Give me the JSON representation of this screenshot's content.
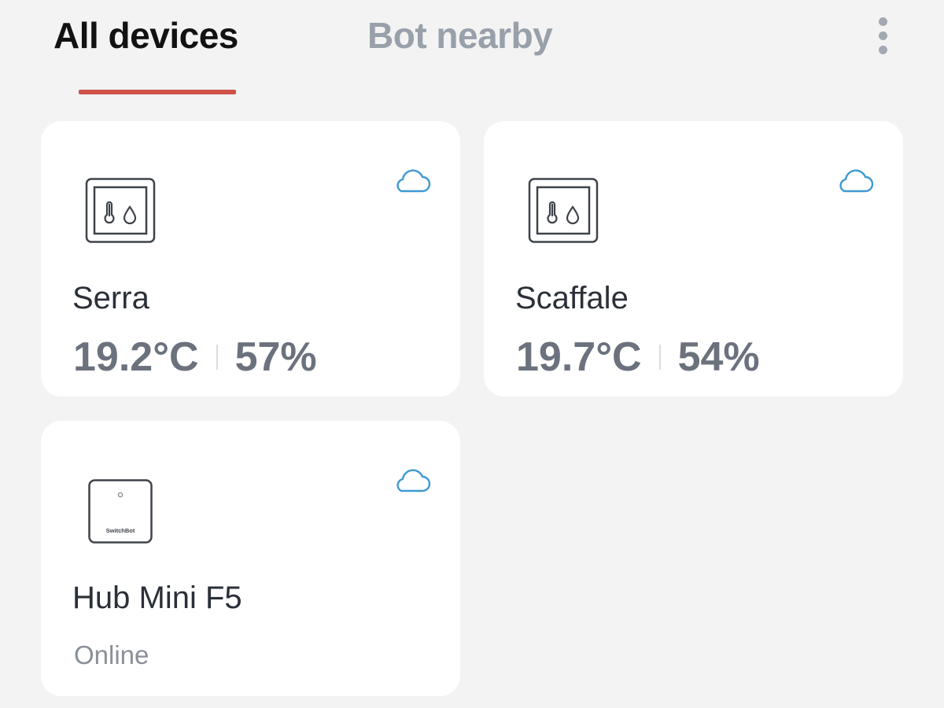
{
  "tabs": {
    "all_devices": "All devices",
    "bot_nearby": "Bot nearby",
    "active": "all_devices"
  },
  "colors": {
    "background": "#f3f3f3",
    "card": "#ffffff",
    "accent_underline": "#cf5148",
    "cloud_icon": "#3e9ad3",
    "inactive_tab": "#98a0aa"
  },
  "devices": [
    {
      "name": "Serra",
      "icon": "thermo-hygrometer-icon",
      "connectivity_icon": "cloud-icon",
      "temperature": "19.2°C",
      "humidity": "57%"
    },
    {
      "name": "Scaffale",
      "icon": "thermo-hygrometer-icon",
      "connectivity_icon": "cloud-icon",
      "temperature": "19.7°C",
      "humidity": "54%"
    },
    {
      "name": "Hub Mini F5",
      "icon": "hub-mini-icon",
      "icon_brand_text": "SwitchBot",
      "connectivity_icon": "cloud-icon",
      "status": "Online"
    }
  ]
}
